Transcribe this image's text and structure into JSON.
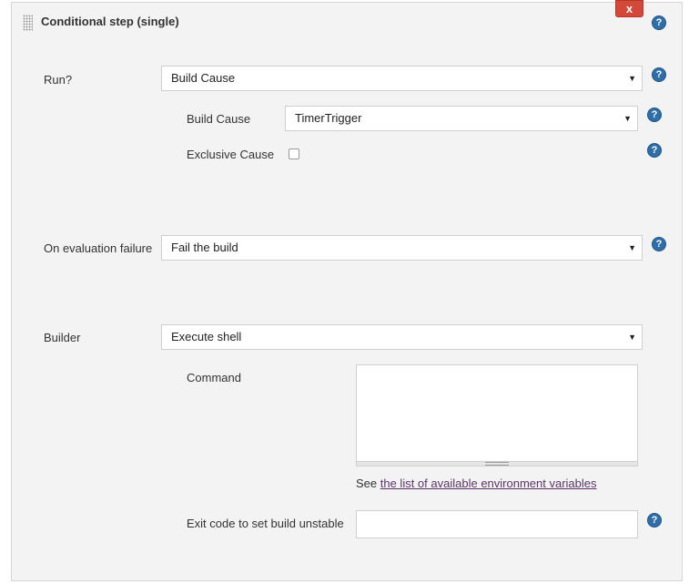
{
  "header": {
    "title": "Conditional step (single)",
    "close_label": "x"
  },
  "help_glyph": "?",
  "fields": {
    "run": {
      "label": "Run?",
      "value": "Build Cause"
    },
    "build_cause": {
      "label": "Build Cause",
      "value": "TimerTrigger"
    },
    "exclusive_cause": {
      "label": "Exclusive Cause",
      "checked": false
    },
    "on_failure": {
      "label": "On evaluation failure",
      "value": "Fail the build"
    },
    "builder": {
      "label": "Builder",
      "value": "Execute shell"
    },
    "command": {
      "label": "Command",
      "value": ""
    },
    "env_note": {
      "prefix": "See ",
      "link_text": "the list of available environment variables"
    },
    "exit_code": {
      "label": "Exit code to set build unstable",
      "value": ""
    }
  },
  "colors": {
    "panel_bg": "#f3f3f3",
    "close_button": "#d24939",
    "help_icon": "#2f6ea8",
    "link": "#5c3566"
  },
  "icons": [
    "drag-handle-icon",
    "help-icon",
    "dropdown-caret-icon",
    "resize-handle-icon"
  ]
}
